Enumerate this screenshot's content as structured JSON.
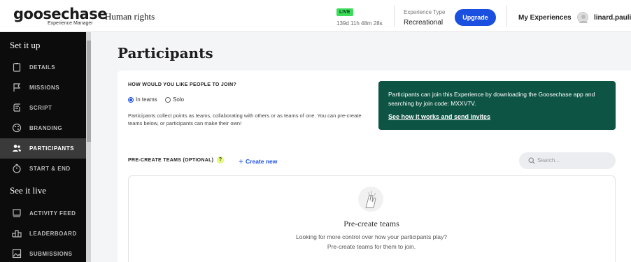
{
  "brand": {
    "name": "goosechase",
    "subtitle": "Experience Manager"
  },
  "header": {
    "experience_name": "Human rights",
    "live_badge": "LIVE",
    "live_countdown": "139d 11h 48m 28s",
    "experience_type_label": "Experience Type",
    "experience_type_value": "Recreational",
    "upgrade_label": "Upgrade",
    "my_experiences_label": "My Experiences",
    "username": "linard.paulin"
  },
  "sidebar": {
    "section_setup": "Set it up",
    "section_live": "See it live",
    "items": [
      {
        "label": "DETAILS",
        "icon": "clipboard-icon"
      },
      {
        "label": "MISSIONS",
        "icon": "flag-icon"
      },
      {
        "label": "SCRIPT",
        "icon": "script-icon"
      },
      {
        "label": "BRANDING",
        "icon": "palette-icon"
      },
      {
        "label": "PARTICIPANTS",
        "icon": "users-icon",
        "active": true
      },
      {
        "label": "START & END",
        "icon": "stopwatch-icon"
      },
      {
        "label": "ACTIVITY FEED",
        "icon": "feed-icon"
      },
      {
        "label": "LEADERBOARD",
        "icon": "podium-icon"
      },
      {
        "label": "SUBMISSIONS",
        "icon": "image-icon"
      }
    ]
  },
  "main": {
    "page_title": "Participants",
    "join_question": "HOW WOULD YOU LIKE PEOPLE TO JOIN?",
    "join_options": [
      {
        "label": "In teams",
        "selected": true
      },
      {
        "label": "Solo",
        "selected": false
      }
    ],
    "join_description": "Participants collect points as teams, collaborating with others or as teams of one. You can pre-create teams below, or participants can make their own!",
    "join_info_text": "Participants can join this Experience by downloading the Goosechase app and searching by join code: MXXV7V.",
    "join_info_link": "See how it works and send invites",
    "precreate_title": "PRE-CREATE TEAMS (OPTIONAL)",
    "help_label": "?",
    "create_new_label": "Create new",
    "search_placeholder": "Search...",
    "empty_title": "Pre-create teams",
    "empty_line1": "Looking for more control over how your participants play?",
    "empty_line2": "Pre-create teams for them to join."
  },
  "colors": {
    "accent": "#1a4fe0",
    "live_badge": "#3ddc5a",
    "info_box": "#0e5444",
    "sidebar_bg": "#0c0c0c",
    "help_badge": "#e6f77a"
  }
}
